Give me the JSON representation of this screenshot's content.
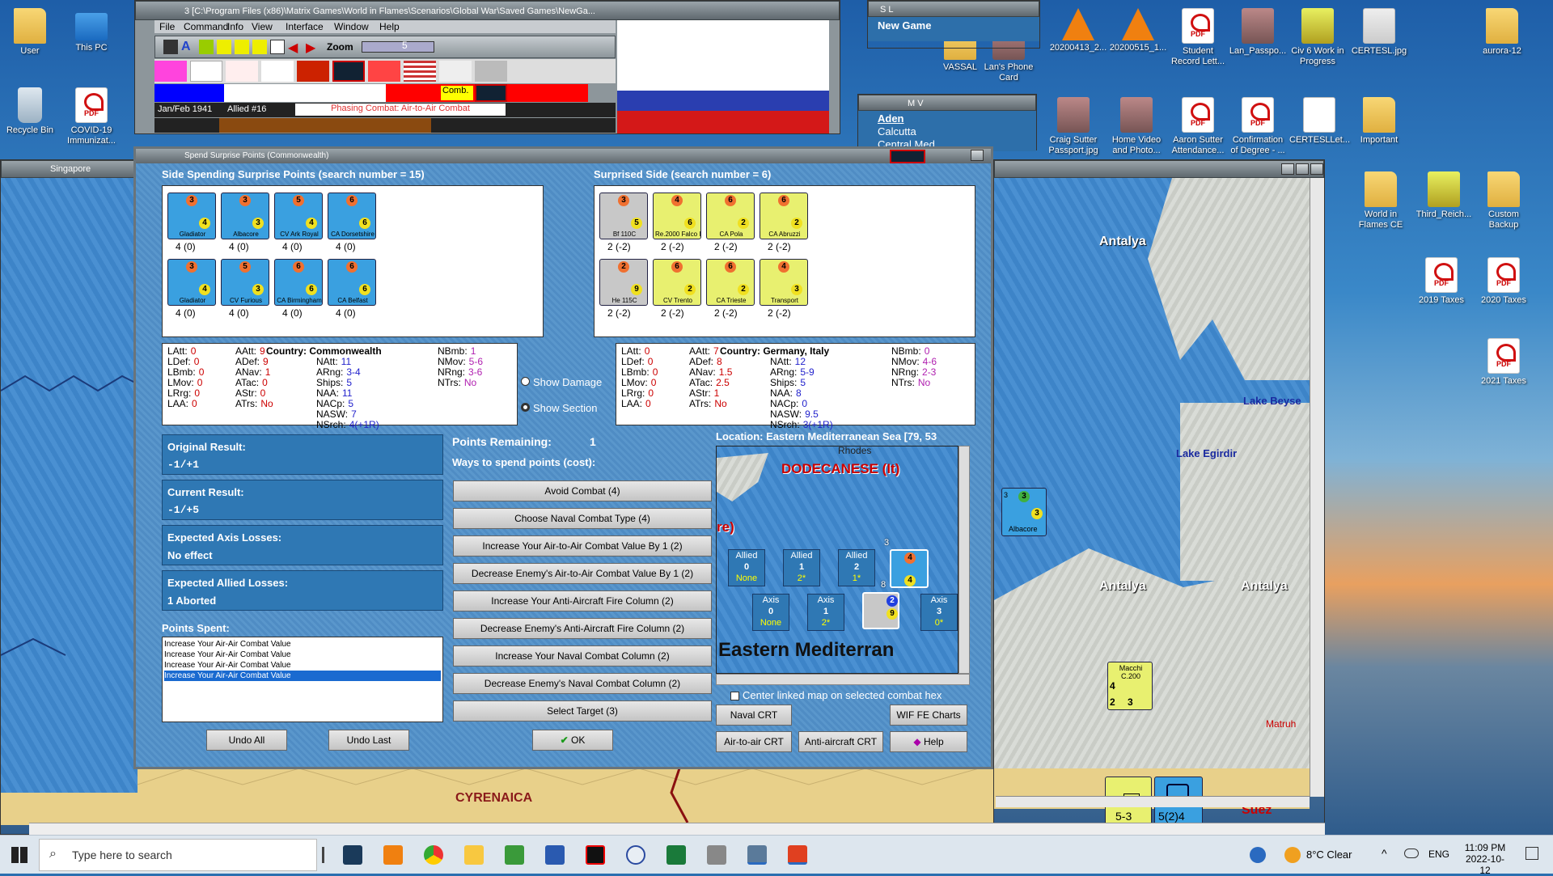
{
  "app_window": {
    "title": "3 [C:\\Program Files (x86)\\Matrix Games\\World in Flames\\Scenarios\\Global War\\Saved Games\\NewGa...",
    "menu": [
      "File",
      "Command",
      "Info",
      "View",
      "Interface",
      "Window",
      "Help"
    ],
    "zoom_label": "Zoom",
    "zoom_value": "5",
    "date": "Jan/Feb 1941",
    "turn": "Allied #16",
    "phase": "Phasing Combat: Air-to-Air Combat",
    "comb_label": "Comb."
  },
  "side_windows": {
    "sl_title": "S L",
    "sl_item": "New Game",
    "mv_title": "M V",
    "mv_items": [
      "Aden",
      "Calcutta",
      "Central Med"
    ],
    "singapore_title": "Singapore"
  },
  "desktop_icons": [
    {
      "label": "User",
      "type": "folder"
    },
    {
      "label": "This PC",
      "type": "pc"
    },
    {
      "label": "Recycle Bin",
      "type": "bin"
    },
    {
      "label": "COVID-19 Immunizat...",
      "type": "pdf"
    },
    {
      "label": "20200413_2...",
      "type": "vlc"
    },
    {
      "label": "20200515_1...",
      "type": "vlc"
    },
    {
      "label": "Student Record Lett...",
      "type": "pdf"
    },
    {
      "label": "Lan_Passpo...",
      "type": "photo"
    },
    {
      "label": "Civ 6 Work in Progress",
      "type": "zipf"
    },
    {
      "label": "CERTESL.jpg",
      "type": "png"
    },
    {
      "label": "aurora-12",
      "type": "folder"
    },
    {
      "label": "Craig Sutter Passport.jpg",
      "type": "photo"
    },
    {
      "label": "Home Video and Photo...",
      "type": "photo"
    },
    {
      "label": "Aaron Sutter Attendance...",
      "type": "pdf"
    },
    {
      "label": "Confirmation of Degree - ...",
      "type": "pdf"
    },
    {
      "label": "CERTESLLet...",
      "type": "doc"
    },
    {
      "label": "Important",
      "type": "folder"
    },
    {
      "label": "World in Flames CE",
      "type": "folder"
    },
    {
      "label": "Third_Reich...",
      "type": "zipf"
    },
    {
      "label": "Custom Backup",
      "type": "folder"
    },
    {
      "label": "2019 Taxes",
      "type": "pdf"
    },
    {
      "label": "2020 Taxes",
      "type": "pdf"
    },
    {
      "label": "2021 Taxes",
      "type": "pdf"
    },
    {
      "label": "VASSAL",
      "type": "folder"
    },
    {
      "label": "Lan's Phone Card",
      "type": "photo"
    }
  ],
  "map_labels": {
    "antalya": "Antalya",
    "lake_beyse": "Lake Beyse",
    "lake_egirdir": "Lake Egirdir",
    "cyrenaica": "CYRENAICA",
    "matruh": "Matruh",
    "suez": "Suez",
    "counter_albacore": "Albacore",
    "counter_macchi": "Macchi C.200",
    "counter_bottom_val": "5(2)4",
    "counter_bottom2": "5-3",
    "stack_8": "8",
    "stack_2": "2"
  },
  "dialog": {
    "title": "Spend Surprise Points (Commonwealth)",
    "left_header": "Side Spending Surprise Points (search number = 15)",
    "right_header": "Surprised Side (search number = 6)",
    "left_units": [
      {
        "name": "Gladiator",
        "top": "3",
        "val": "4",
        "foot": "4 (0)"
      },
      {
        "name": "Albacore",
        "top": "3",
        "val": "3",
        "foot": "4 (0)"
      },
      {
        "name": "CV Ark Royal",
        "top": "5",
        "val": "4",
        "foot": "4 (0)"
      },
      {
        "name": "CA Dorsetshire",
        "top": "6",
        "val": "6",
        "foot": "4 (0)"
      },
      {
        "name": "Gladiator",
        "top": "3",
        "val": "4",
        "foot": "4 (0)"
      },
      {
        "name": "CV Furious",
        "top": "5",
        "val": "3",
        "foot": "4 (0)"
      },
      {
        "name": "CA Birmingham",
        "top": "6",
        "val": "6",
        "foot": "4 (0)"
      },
      {
        "name": "CA Belfast",
        "top": "6",
        "val": "6",
        "foot": "4 (0)"
      }
    ],
    "right_units": [
      {
        "name": "Bf 110C",
        "top": "3",
        "val": "5",
        "foot": "2 (-2)",
        "color": "grey"
      },
      {
        "name": "Re.2000 Falco I",
        "top": "4",
        "val": "6",
        "foot": "2 (-2)",
        "color": "yel"
      },
      {
        "name": "CA Pola",
        "top": "6",
        "val": "2",
        "foot": "2 (-2)",
        "color": "yel"
      },
      {
        "name": "CA Abruzzi",
        "top": "6",
        "val": "2",
        "foot": "2 (-2)",
        "color": "yel"
      },
      {
        "name": "He 115C",
        "top": "2",
        "val": "9",
        "foot": "2 (-2)",
        "color": "grey"
      },
      {
        "name": "CV Trento",
        "top": "6",
        "val": "2",
        "foot": "2 (-2)",
        "color": "yel"
      },
      {
        "name": "CA Trieste",
        "top": "6",
        "val": "2",
        "foot": "2 (-2)",
        "color": "yel"
      },
      {
        "name": "Transport",
        "top": "4",
        "val": "3",
        "foot": "2 (-2)",
        "color": "yel"
      }
    ],
    "left_stats": {
      "country": "Country: Commonwealth",
      "col1": [
        [
          "LAtt:",
          "0"
        ],
        [
          "LDef:",
          "0"
        ],
        [
          "LBmb:",
          "0"
        ],
        [
          "LMov:",
          "0"
        ],
        [
          "LRrg:",
          "0"
        ],
        [
          "LAA:",
          "0"
        ]
      ],
      "col2": [
        [
          "AAtt:",
          "9"
        ],
        [
          "ADef:",
          "9"
        ],
        [
          "ANav:",
          "1"
        ],
        [
          "ATac:",
          "0"
        ],
        [
          "AStr:",
          "0"
        ],
        [
          "ATrs:",
          "No"
        ]
      ],
      "col3": [
        [
          "NAtt:",
          "11"
        ],
        [
          "ARng:",
          "3-4"
        ],
        [
          "Ships:",
          "5"
        ],
        [
          "NAA:",
          "11"
        ],
        [
          "NACp:",
          "5"
        ],
        [
          "NASW:",
          "7"
        ],
        [
          "NSrch:",
          "4(+1R)"
        ]
      ],
      "col4": [
        [
          "NBmb:",
          "1"
        ],
        [
          "NMov:",
          "5-6"
        ],
        [
          "NRng:",
          "3-6"
        ],
        [
          "NTrs:",
          "No"
        ]
      ]
    },
    "right_stats": {
      "country": "Country: Germany, Italy",
      "col1": [
        [
          "LAtt:",
          "0"
        ],
        [
          "LDef:",
          "0"
        ],
        [
          "LBmb:",
          "0"
        ],
        [
          "LMov:",
          "0"
        ],
        [
          "LRrg:",
          "0"
        ],
        [
          "LAA:",
          "0"
        ]
      ],
      "col2": [
        [
          "AAtt:",
          "7"
        ],
        [
          "ADef:",
          "8"
        ],
        [
          "ANav:",
          "1.5"
        ],
        [
          "ATac:",
          "2.5"
        ],
        [
          "AStr:",
          "1"
        ],
        [
          "ATrs:",
          "No"
        ]
      ],
      "col3": [
        [
          "NAtt:",
          "12"
        ],
        [
          "ARng:",
          "5-9"
        ],
        [
          "Ships:",
          "5"
        ],
        [
          "NAA:",
          "8"
        ],
        [
          "NACp:",
          "0"
        ],
        [
          "NASW:",
          "9.5"
        ],
        [
          "NSrch:",
          "3(+1R)"
        ]
      ],
      "col4": [
        [
          "NBmb:",
          "0"
        ],
        [
          "NMov:",
          "4-6"
        ],
        [
          "NRng:",
          "2-3"
        ],
        [
          "NTrs:",
          "No"
        ]
      ]
    },
    "show_damage": "Show Damage",
    "show_section": "Show Section",
    "original_result_label": "Original Result:",
    "original_result": "-1/+1",
    "current_result_label": "Current Result:",
    "current_result": "-1/+5",
    "axis_losses_label": "Expected Axis Losses:",
    "axis_losses": "No effect",
    "allied_losses_label": "Expected Allied Losses:",
    "allied_losses": "1 Aborted",
    "points_spent_label": "Points Spent:",
    "points_spent": [
      "Increase Your Air-Air Combat Value",
      "Increase Your Air-Air Combat Value",
      "Increase Your Air-Air Combat Value",
      "Increase Your Air-Air Combat Value"
    ],
    "points_remaining_label": "Points Remaining:",
    "points_remaining": "1",
    "ways_label": "Ways to spend points (cost):",
    "options": [
      "Avoid Combat (4)",
      "Choose Naval Combat Type (4)",
      "Increase Your Air-to-Air Combat Value By 1 (2)",
      "Decrease Enemy's Air-to-Air Combat Value By 1 (2)",
      "Increase Your Anti-Aircraft Fire Column (2)",
      "Decrease Enemy's Anti-Aircraft Fire Column (2)",
      "Increase Your Naval Combat Column (2)",
      "Decrease Enemy's Naval Combat Column (2)",
      "Select Target (3)"
    ],
    "location": "Location: Eastern Mediterranean Sea [79, 53",
    "mini_map": {
      "rhodes": "Rhodes",
      "dodecanese": "DODECANESE (It)",
      "re": "re)",
      "eastern_med": "Eastern Mediterran",
      "allied_boxes": [
        {
          "side": "Allied",
          "n": "0",
          "v": "None"
        },
        {
          "side": "Allied",
          "n": "1",
          "v": "2*"
        },
        {
          "side": "Allied",
          "n": "2",
          "v": "1*"
        }
      ],
      "axis_boxes": [
        {
          "side": "Axis",
          "n": "0",
          "v": "None"
        },
        {
          "side": "Axis",
          "n": "1",
          "v": "2*"
        },
        {
          "side": "Axis",
          "n": "3",
          "v": "0*"
        }
      ],
      "stack_3": "3",
      "stack_8": "8"
    },
    "center_linked": "Center linked map on selected combat hex",
    "buttons": {
      "naval_crt": "Naval CRT",
      "wif_fe_charts": "WIF FE Charts",
      "air_to_air_crt": "Air-to-air CRT",
      "anti_aircraft_crt": "Anti-aircraft CRT",
      "help": "Help",
      "undo_all": "Undo All",
      "undo_last": "Undo Last",
      "ok": "OK"
    }
  },
  "taskbar": {
    "search_placeholder": "Type here to search",
    "weather": "8°C  Clear",
    "lang": "ENG",
    "time": "11:09 PM",
    "date": "2022-10-12"
  },
  "colors": {
    "dialog_blue": "#4f8cc4",
    "result_box": "#2f78b4",
    "sea": "#3d84c8"
  }
}
